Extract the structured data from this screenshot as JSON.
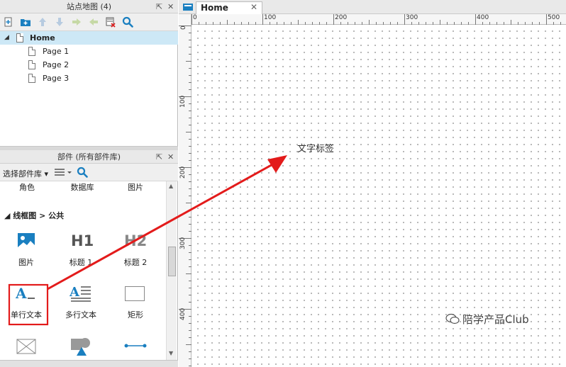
{
  "sitemap": {
    "title": "站点地图 (4)",
    "pin": "⇱",
    "close": "✕",
    "pages": [
      {
        "label": "Home",
        "selected": true
      },
      {
        "label": "Page 1"
      },
      {
        "label": "Page 2"
      },
      {
        "label": "Page 3"
      }
    ]
  },
  "widgets": {
    "title": "部件 (所有部件库)",
    "pin": "⇱",
    "close": "✕",
    "library_select": "选择部件库 ▾",
    "top_row": [
      "角色",
      "数据库",
      "图片"
    ],
    "section": "◢ 线框图 > 公共",
    "items": [
      {
        "label": "图片",
        "icon": "image-icon"
      },
      {
        "label": "标题 1",
        "icon": "h1-icon",
        "glyph": "H1"
      },
      {
        "label": "标题 2",
        "icon": "h2-icon",
        "glyph": "H2"
      },
      {
        "label": "单行文本",
        "icon": "text-label-icon",
        "highlighted": true
      },
      {
        "label": "多行文本",
        "icon": "paragraph-icon"
      },
      {
        "label": "矩形",
        "icon": "rectangle-icon"
      }
    ]
  },
  "editor": {
    "tab": "Home",
    "tab_close": "✕",
    "ruler_top": [
      "0",
      "100",
      "200",
      "300",
      "400",
      "500"
    ],
    "ruler_left": [
      "0",
      "100",
      "200",
      "300",
      "400"
    ]
  },
  "canvas": {
    "text_widget": "文字标签"
  },
  "watermark": "陪学产品Club",
  "colors": {
    "accent": "#1a7fc0",
    "selection": "#cde8f6",
    "annotation": "#e31b1b"
  }
}
